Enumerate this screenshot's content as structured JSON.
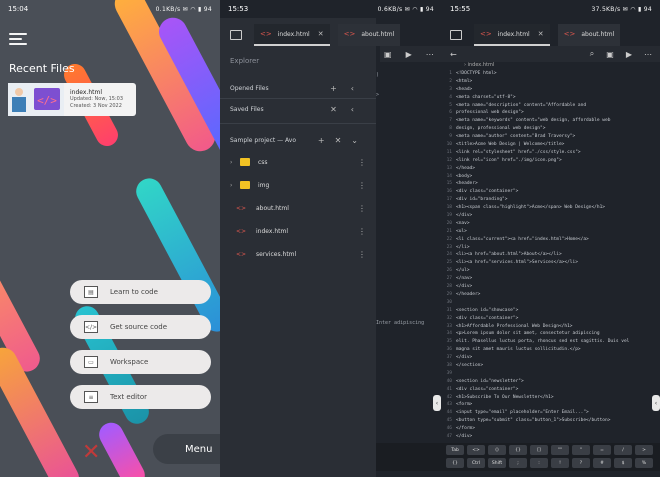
{
  "panel1": {
    "status_time": "15:04",
    "status_right": "0.1KB/s ✉ ◠ ▮ 94",
    "recent_title": "Recent Files",
    "recent_file": {
      "name": "index.html",
      "line1": "Updated: Now, 15:03",
      "line2": "Created: 3 Nov 2022"
    },
    "menu": [
      {
        "label": "Learn to code",
        "icon": "book-icon"
      },
      {
        "label": "Get source code",
        "icon": "code-icon"
      },
      {
        "label": "Workspace",
        "icon": "folder-icon"
      },
      {
        "label": "Text editor",
        "icon": "document-icon"
      }
    ],
    "fab_label": "Menu"
  },
  "panel2": {
    "status_time": "15:53",
    "status_right": "0.6KB/s ✉ ◠ ▮ 94",
    "tabs": [
      {
        "label": "index.html",
        "active": true
      },
      {
        "label": "about.html",
        "active": false
      }
    ],
    "explorer_label": "Explorer",
    "sections": [
      {
        "label": "Opened Files"
      },
      {
        "label": "Saved Files"
      },
      {
        "label": "Sample project — Avo"
      }
    ],
    "tree": [
      {
        "type": "folder",
        "label": "css"
      },
      {
        "type": "folder",
        "label": "img"
      },
      {
        "type": "file",
        "label": "about.html"
      },
      {
        "type": "file",
        "label": "index.html"
      },
      {
        "type": "file",
        "label": "services.html"
      }
    ],
    "peek_lines": [
      "",
      "",
      ")",
      "",
      ">",
      "",
      "",
      "",
      "",
      "",
      "",
      "",
      ">",
      "",
      ">",
      "",
      "",
      "",
      "",
      "",
      "web Design</",
      "",
      "",
      "",
      "",
      "",
      "",
      "",
      "",
      "",
      "",
      "",
      "",
      "",
      "",
      "",
      "",
      "",
      "",
      "",
      ""
    ],
    "peek_tail": "Inter adipiscing"
  },
  "panel3": {
    "status_time": "15:55",
    "status_right": "37.5KB/s ✉ ◠ ▮ 94",
    "tabs": [
      {
        "label": "index.html",
        "active": true
      },
      {
        "label": "about.html",
        "active": false
      }
    ],
    "crumb": "› index.html",
    "lines": [
      "<!DOCTYPE html>",
      "<html>",
      "  <head>",
      "    <meta charset=\"utf-8\">",
      "    <meta name=\"description\" content=\"Affordable and",
      "professional web design\">",
      "    <meta name=\"keywords\" content=\"web design, affordable web",
      "design, professional web design\">",
      "    <meta name=\"author\" content=\"Brad Traversy\">",
      "    <title>Acme Web Design | Welcome</title>",
      "    <link rel=\"stylesheet\" href=\"./css/style.css\">",
      "    <link rel=\"icon\" href=\"./img/icon.png\">",
      "  </head>",
      "  <body>",
      "    <header>",
      "      <div class=\"container\">",
      "        <div id=\"branding\">",
      "          <h1><span class=\"highlight\">Acme</span> Web Design</h1>",
      "        </div>",
      "        <nav>",
      "          <ul>",
      "            <li class=\"current\"><a href=\"index.html\">Home</a>",
      "</li>",
      "            <li><a href=\"about.html\">About</a></li>",
      "            <li><a href=\"services.html\">Services</a></li>",
      "          </ul>",
      "        </nav>",
      "      </div>",
      "    </header>",
      "",
      "    <section id=\"showcase\">",
      "      <div class=\"container\">",
      "        <h1>Affordable Professional Web Design</h1>",
      "        <p>Lorem ipsum dolor sit amet, consectetur adipiscing",
      "elit. Phasellus luctus porta, rhoncus sed est sagittis. Duis vel",
      "magna sit amet mauris luctus sollicitudin.</p>",
      "      </div>",
      "    </section>",
      "",
      "    <section id=\"newsletter\">",
      "      <div class=\"container\">",
      "        <h1>Subscribe To Our Newsletter</h1>",
      "        <form>",
      "          <input type=\"email\" placeholder=\"Enter Email...\">",
      "          <button type=\"submit\" class=\"button_1\">Subscribe</button>",
      "        </form>",
      "      </div>"
    ],
    "keys_row1": [
      "Tab",
      "<>",
      "()",
      "{}",
      "[]",
      "\"\"",
      "''",
      "=",
      "/",
      ">"
    ],
    "keys_row2": [
      "{}",
      "Ctrl",
      "Shift",
      ";",
      ":",
      "!",
      "?",
      "#",
      "$",
      "%"
    ]
  }
}
